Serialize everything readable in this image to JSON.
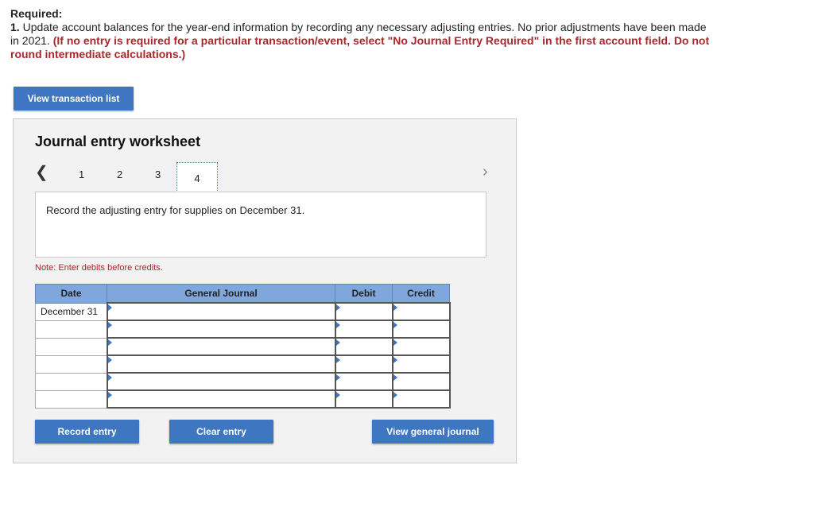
{
  "instructions": {
    "required_label": "Required:",
    "item_number": "1.",
    "item_text": "Update account balances for the year-end information by recording any necessary adjusting entries. No prior adjustments have been made in 2021.",
    "item_emphasis": "(If no entry is required for a particular transaction/event, select \"No Journal Entry Required\" in the first account field. Do not round intermediate calculations.)"
  },
  "buttons": {
    "view_transactions": "View transaction list",
    "record_entry": "Record entry",
    "clear_entry": "Clear entry",
    "view_journal": "View general journal"
  },
  "worksheet": {
    "title": "Journal entry worksheet",
    "prev_icon": "chevron-left-icon",
    "next_icon": "chevron-right-icon",
    "steps": [
      "1",
      "2",
      "3",
      "4"
    ],
    "active_step": "4",
    "description": "Record the adjusting entry for supplies on December 31.",
    "note": "Note: Enter debits before credits."
  },
  "table": {
    "headers": [
      "Date",
      "General Journal",
      "Debit",
      "Credit"
    ],
    "rows": [
      {
        "date": "December 31",
        "account": "",
        "debit": "",
        "credit": ""
      },
      {
        "date": "",
        "account": "",
        "debit": "",
        "credit": ""
      },
      {
        "date": "",
        "account": "",
        "debit": "",
        "credit": ""
      },
      {
        "date": "",
        "account": "",
        "debit": "",
        "credit": ""
      },
      {
        "date": "",
        "account": "",
        "debit": "",
        "credit": ""
      },
      {
        "date": "",
        "account": "",
        "debit": "",
        "credit": ""
      }
    ]
  },
  "colors": {
    "accent": "#3f76c1",
    "header_bg": "#7fa7db",
    "emphasis_red": "#a8282b",
    "panel_bg": "#f2f2f2"
  }
}
